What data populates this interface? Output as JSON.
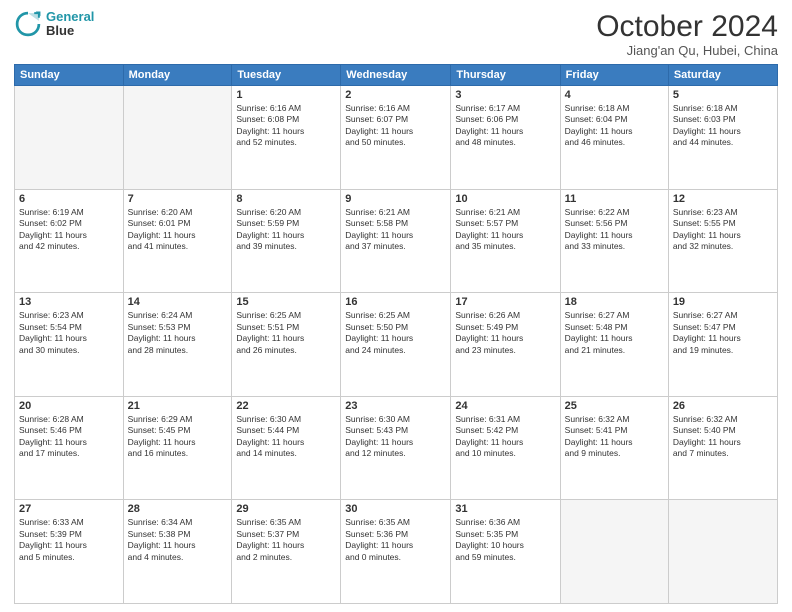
{
  "header": {
    "logo_line1": "General",
    "logo_line2": "Blue",
    "month": "October 2024",
    "location": "Jiang'an Qu, Hubei, China"
  },
  "weekdays": [
    "Sunday",
    "Monday",
    "Tuesday",
    "Wednesday",
    "Thursday",
    "Friday",
    "Saturday"
  ],
  "weeks": [
    [
      {
        "day": "",
        "info": ""
      },
      {
        "day": "",
        "info": ""
      },
      {
        "day": "1",
        "info": "Sunrise: 6:16 AM\nSunset: 6:08 PM\nDaylight: 11 hours\nand 52 minutes."
      },
      {
        "day": "2",
        "info": "Sunrise: 6:16 AM\nSunset: 6:07 PM\nDaylight: 11 hours\nand 50 minutes."
      },
      {
        "day": "3",
        "info": "Sunrise: 6:17 AM\nSunset: 6:06 PM\nDaylight: 11 hours\nand 48 minutes."
      },
      {
        "day": "4",
        "info": "Sunrise: 6:18 AM\nSunset: 6:04 PM\nDaylight: 11 hours\nand 46 minutes."
      },
      {
        "day": "5",
        "info": "Sunrise: 6:18 AM\nSunset: 6:03 PM\nDaylight: 11 hours\nand 44 minutes."
      }
    ],
    [
      {
        "day": "6",
        "info": "Sunrise: 6:19 AM\nSunset: 6:02 PM\nDaylight: 11 hours\nand 42 minutes."
      },
      {
        "day": "7",
        "info": "Sunrise: 6:20 AM\nSunset: 6:01 PM\nDaylight: 11 hours\nand 41 minutes."
      },
      {
        "day": "8",
        "info": "Sunrise: 6:20 AM\nSunset: 5:59 PM\nDaylight: 11 hours\nand 39 minutes."
      },
      {
        "day": "9",
        "info": "Sunrise: 6:21 AM\nSunset: 5:58 PM\nDaylight: 11 hours\nand 37 minutes."
      },
      {
        "day": "10",
        "info": "Sunrise: 6:21 AM\nSunset: 5:57 PM\nDaylight: 11 hours\nand 35 minutes."
      },
      {
        "day": "11",
        "info": "Sunrise: 6:22 AM\nSunset: 5:56 PM\nDaylight: 11 hours\nand 33 minutes."
      },
      {
        "day": "12",
        "info": "Sunrise: 6:23 AM\nSunset: 5:55 PM\nDaylight: 11 hours\nand 32 minutes."
      }
    ],
    [
      {
        "day": "13",
        "info": "Sunrise: 6:23 AM\nSunset: 5:54 PM\nDaylight: 11 hours\nand 30 minutes."
      },
      {
        "day": "14",
        "info": "Sunrise: 6:24 AM\nSunset: 5:53 PM\nDaylight: 11 hours\nand 28 minutes."
      },
      {
        "day": "15",
        "info": "Sunrise: 6:25 AM\nSunset: 5:51 PM\nDaylight: 11 hours\nand 26 minutes."
      },
      {
        "day": "16",
        "info": "Sunrise: 6:25 AM\nSunset: 5:50 PM\nDaylight: 11 hours\nand 24 minutes."
      },
      {
        "day": "17",
        "info": "Sunrise: 6:26 AM\nSunset: 5:49 PM\nDaylight: 11 hours\nand 23 minutes."
      },
      {
        "day": "18",
        "info": "Sunrise: 6:27 AM\nSunset: 5:48 PM\nDaylight: 11 hours\nand 21 minutes."
      },
      {
        "day": "19",
        "info": "Sunrise: 6:27 AM\nSunset: 5:47 PM\nDaylight: 11 hours\nand 19 minutes."
      }
    ],
    [
      {
        "day": "20",
        "info": "Sunrise: 6:28 AM\nSunset: 5:46 PM\nDaylight: 11 hours\nand 17 minutes."
      },
      {
        "day": "21",
        "info": "Sunrise: 6:29 AM\nSunset: 5:45 PM\nDaylight: 11 hours\nand 16 minutes."
      },
      {
        "day": "22",
        "info": "Sunrise: 6:30 AM\nSunset: 5:44 PM\nDaylight: 11 hours\nand 14 minutes."
      },
      {
        "day": "23",
        "info": "Sunrise: 6:30 AM\nSunset: 5:43 PM\nDaylight: 11 hours\nand 12 minutes."
      },
      {
        "day": "24",
        "info": "Sunrise: 6:31 AM\nSunset: 5:42 PM\nDaylight: 11 hours\nand 10 minutes."
      },
      {
        "day": "25",
        "info": "Sunrise: 6:32 AM\nSunset: 5:41 PM\nDaylight: 11 hours\nand 9 minutes."
      },
      {
        "day": "26",
        "info": "Sunrise: 6:32 AM\nSunset: 5:40 PM\nDaylight: 11 hours\nand 7 minutes."
      }
    ],
    [
      {
        "day": "27",
        "info": "Sunrise: 6:33 AM\nSunset: 5:39 PM\nDaylight: 11 hours\nand 5 minutes."
      },
      {
        "day": "28",
        "info": "Sunrise: 6:34 AM\nSunset: 5:38 PM\nDaylight: 11 hours\nand 4 minutes."
      },
      {
        "day": "29",
        "info": "Sunrise: 6:35 AM\nSunset: 5:37 PM\nDaylight: 11 hours\nand 2 minutes."
      },
      {
        "day": "30",
        "info": "Sunrise: 6:35 AM\nSunset: 5:36 PM\nDaylight: 11 hours\nand 0 minutes."
      },
      {
        "day": "31",
        "info": "Sunrise: 6:36 AM\nSunset: 5:35 PM\nDaylight: 10 hours\nand 59 minutes."
      },
      {
        "day": "",
        "info": ""
      },
      {
        "day": "",
        "info": ""
      }
    ]
  ]
}
